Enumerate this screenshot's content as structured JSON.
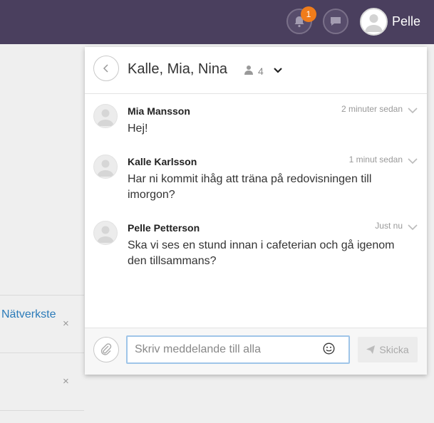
{
  "topbar": {
    "notification_count": "1",
    "user_name": "Pelle"
  },
  "background": {
    "link_text": "Nätverkste",
    "close_symbol": "×"
  },
  "chat": {
    "title": "Kalle, Mia, Nina",
    "member_count": "4",
    "messages": [
      {
        "author": "Mia Mansson",
        "time": "2 minuter sedan",
        "text": "Hej!"
      },
      {
        "author": "Kalle Karlsson",
        "time": "1 minut sedan",
        "text": "Har ni kommit ihåg att träna på redovisningen till imorgon?"
      },
      {
        "author": "Pelle Petterson",
        "time": "Just nu",
        "text": "Ska vi ses en stund innan i cafeterian och gå igenom den tillsammans?"
      }
    ],
    "composer": {
      "placeholder": "Skriv meddelande till alla",
      "send_label": "Skicka"
    }
  },
  "colors": {
    "topbar": "#4a3f5e",
    "badge": "#f07c1b",
    "link": "#2b7bb9",
    "input_focus": "#9fc5e8"
  }
}
